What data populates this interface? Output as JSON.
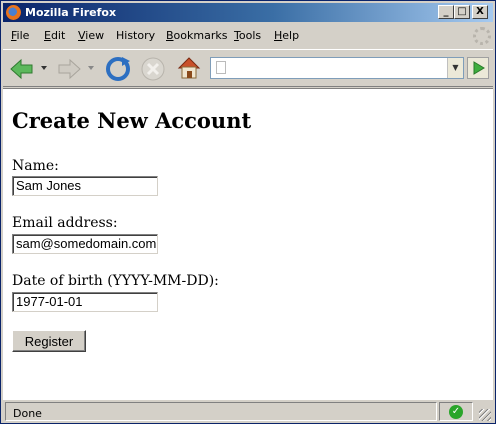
{
  "window": {
    "title": "Mozilla Firefox",
    "controls": {
      "minimize": "_",
      "maximize": "□",
      "close": "X"
    }
  },
  "menubar": {
    "items": [
      {
        "label": "File",
        "underline": "F",
        "rest": "ile"
      },
      {
        "label": "Edit",
        "underline": "E",
        "rest": "dit"
      },
      {
        "label": "View",
        "underline": "V",
        "rest": "iew"
      },
      {
        "label": "History",
        "underline": "",
        "rest": "History"
      },
      {
        "label": "Bookmarks",
        "underline": "B",
        "rest": "ookmarks"
      },
      {
        "label": "Tools",
        "underline": "T",
        "rest": "ools"
      },
      {
        "label": "Help",
        "underline": "H",
        "rest": "elp"
      }
    ]
  },
  "toolbar": {
    "icons": [
      "back-arrow-icon",
      "forward-arrow-icon",
      "reload-icon",
      "stop-icon",
      "home-icon",
      "go-arrow-icon"
    ],
    "url": {
      "value": "",
      "placeholder": ""
    },
    "accent_color": "#3fae3f"
  },
  "page": {
    "title": "Create New Account",
    "fields": {
      "name": {
        "label": "Name:",
        "value": "Sam Jones"
      },
      "email": {
        "label": "Email address:",
        "value": "sam@somedomain.com"
      },
      "dob": {
        "label": "Date of birth (YYYY-MM-DD):",
        "value": "1977-01-01"
      }
    },
    "register_label": "Register"
  },
  "status": {
    "text": "Done",
    "secure_icon": "check-icon",
    "secure_color": "#2aa52a"
  }
}
